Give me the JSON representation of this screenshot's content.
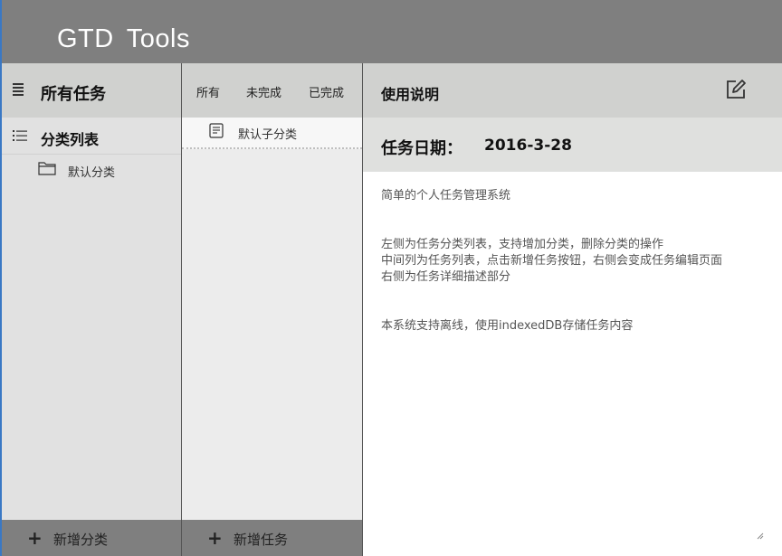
{
  "app": {
    "title": "GTD Tools"
  },
  "left": {
    "header": {
      "title": "所有任务",
      "icon": "menu-icon"
    },
    "category_header": {
      "title": "分类列表",
      "icon": "list-icon"
    },
    "categories": [
      {
        "label": "默认分类",
        "icon": "folder-icon"
      }
    ],
    "footer": {
      "label": "新增分类",
      "icon": "+"
    }
  },
  "middle": {
    "tabs": [
      {
        "label": "所有"
      },
      {
        "label": "未完成"
      },
      {
        "label": "已完成"
      }
    ],
    "items": [
      {
        "label": "默认子分类",
        "icon": "document-icon"
      }
    ],
    "footer": {
      "label": "新增任务",
      "icon": "+"
    }
  },
  "right": {
    "header": {
      "title": "使用说明",
      "icon": "edit-icon"
    },
    "date": {
      "label": "任务日期：",
      "value": "2016-3-28"
    },
    "description": [
      "简单的个人任务管理系统",
      "",
      "左侧为任务分类列表，支持增加分类，删除分类的操作",
      "中间列为任务列表，点击新增任务按钮，右侧会变成任务编辑页面",
      "右侧为任务详细描述部分",
      "",
      "本系统支持离线，使用indexedDB存储任务内容"
    ]
  },
  "colors": {
    "header_bg": "#7f7f7f",
    "panel_header_bg": "#d0d1cf",
    "left_bg": "#e1e1e1",
    "mid_bg": "#ececec",
    "accent_border": "#3a78c4"
  }
}
